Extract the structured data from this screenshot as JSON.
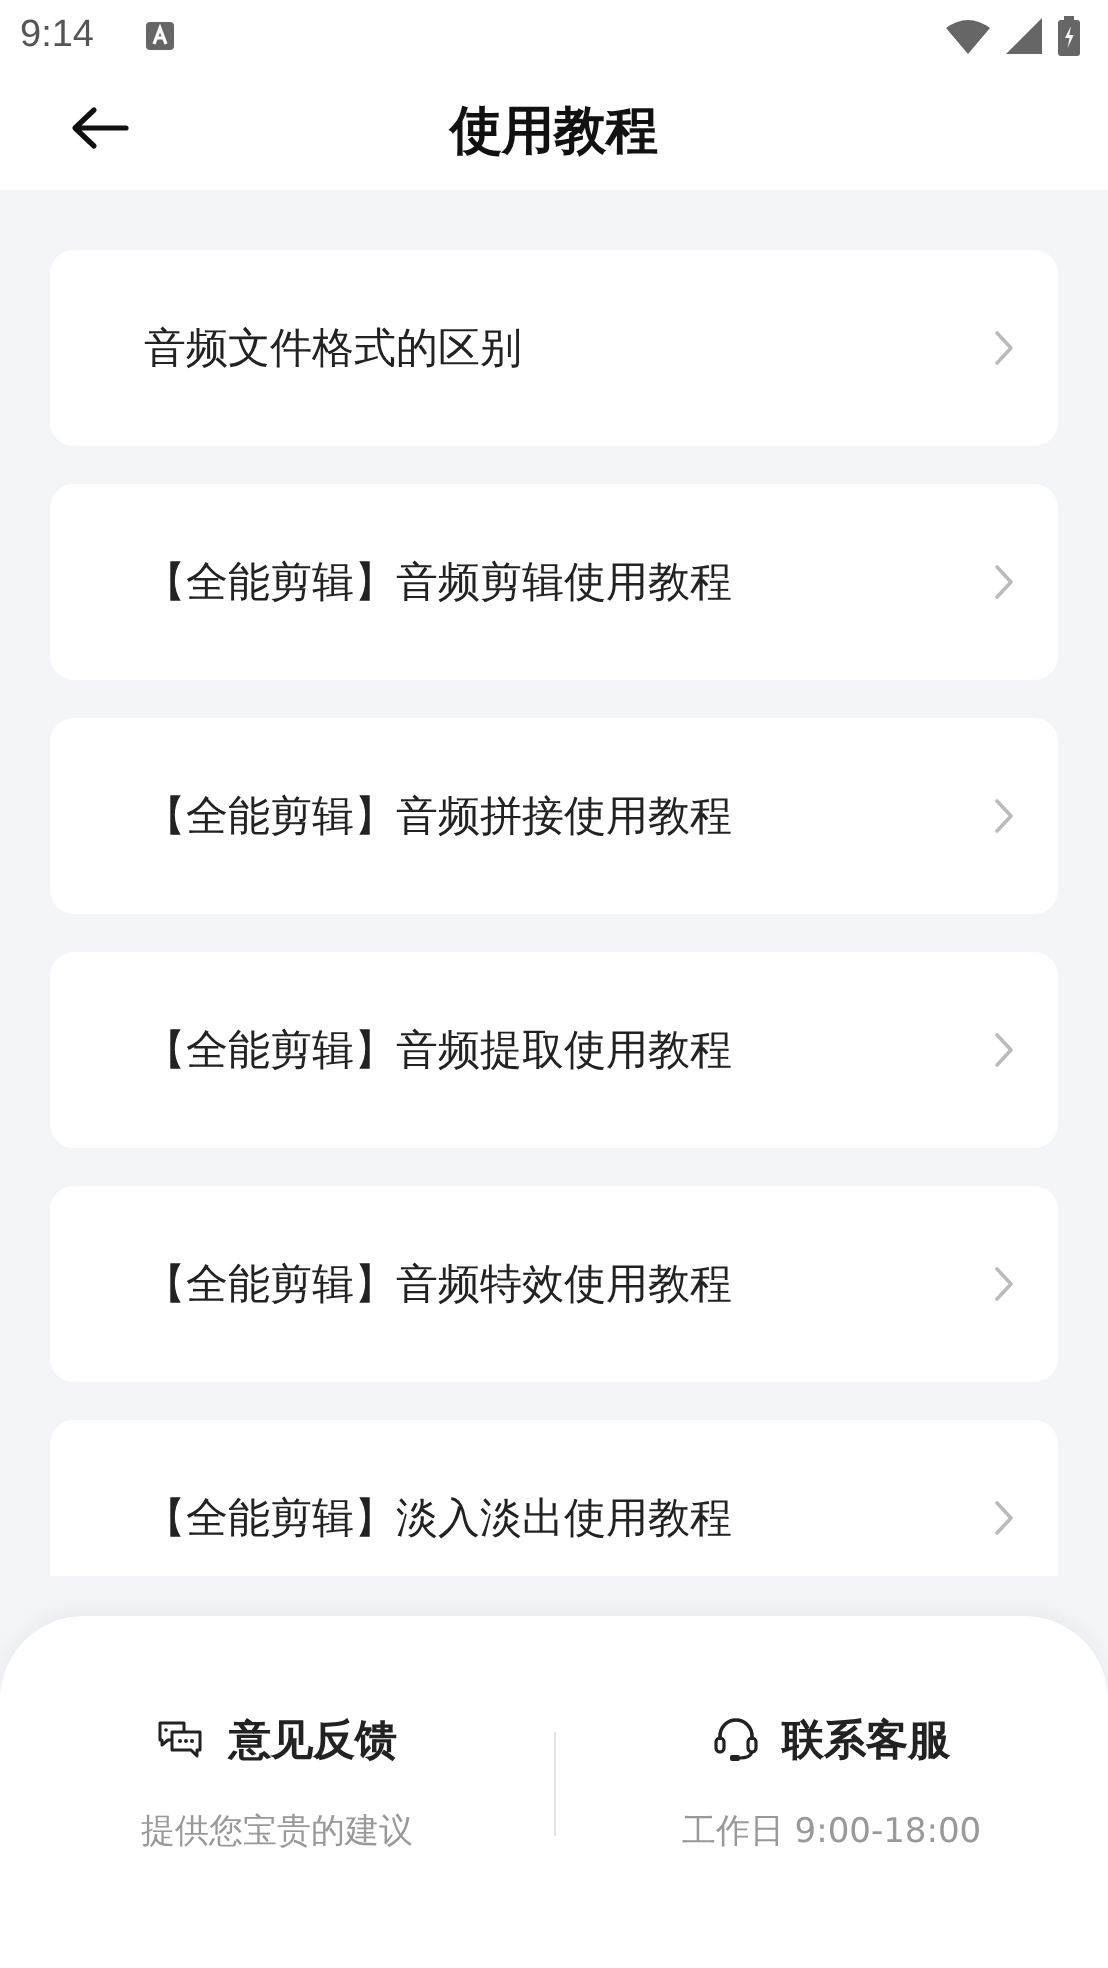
{
  "status_bar": {
    "time": "9:14"
  },
  "header": {
    "title": "使用教程"
  },
  "tutorials": [
    {
      "label": "音频文件格式的区别"
    },
    {
      "label": "【全能剪辑】音频剪辑使用教程"
    },
    {
      "label": "【全能剪辑】音频拼接使用教程"
    },
    {
      "label": "【全能剪辑】音频提取使用教程"
    },
    {
      "label": "【全能剪辑】音频特效使用教程"
    },
    {
      "label": "【全能剪辑】淡入淡出使用教程"
    }
  ],
  "footer": [
    {
      "kind": "feedback",
      "title": "意见反馈",
      "subtitle": "提供您宝贵的建议"
    },
    {
      "kind": "support",
      "title": "联系客服",
      "subtitle": "工作日 9:00-18:00"
    }
  ]
}
